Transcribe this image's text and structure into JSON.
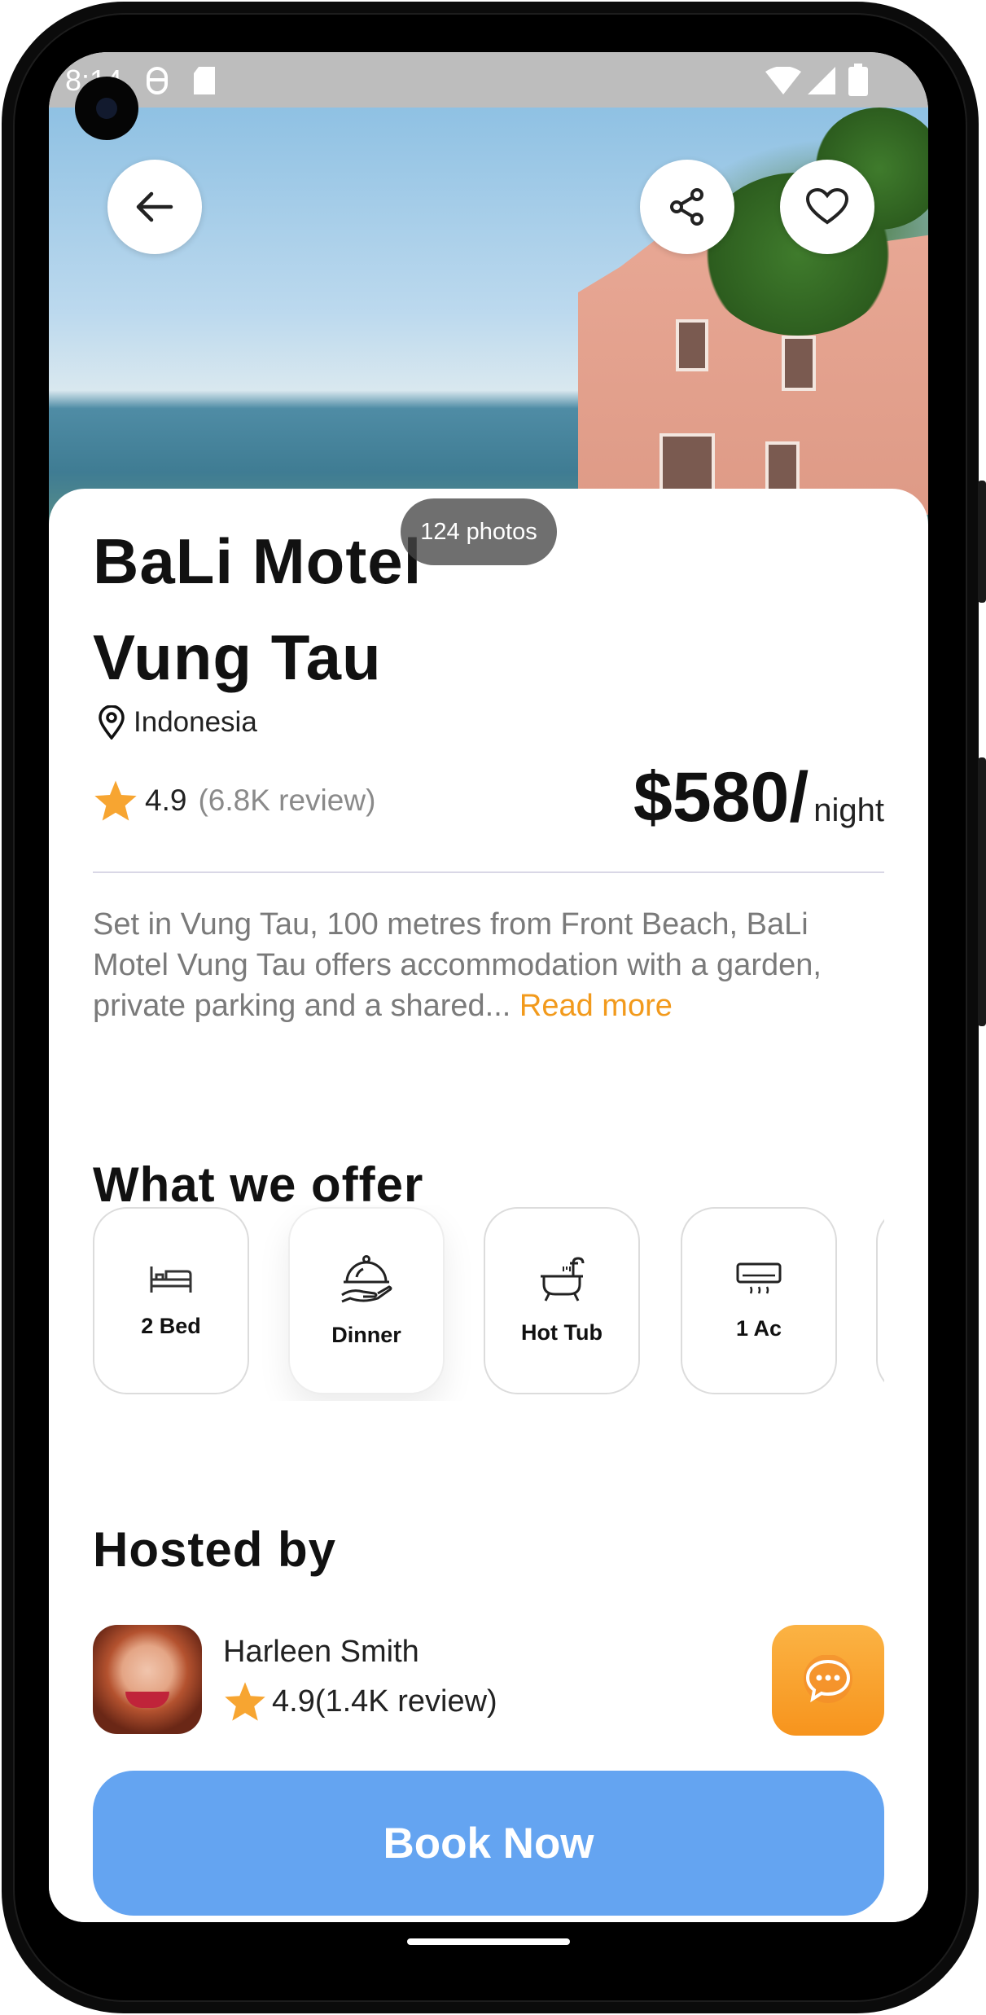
{
  "status_bar": {
    "time": "8:14"
  },
  "hero": {
    "photos_label": "124 photos"
  },
  "listing": {
    "title_line1": "BaLi Motel",
    "title_line2": "Vung Tau",
    "location": "Indonesia",
    "rating": "4.9",
    "reviews": "(6.8K review)",
    "price": "$580/",
    "price_unit": "night",
    "description": "Set in Vung Tau, 100 metres from Front Beach, BaLi Motel Vung Tau offers accommodation with a garden, private parking and a shared...",
    "read_more": "Read more"
  },
  "offers": {
    "heading": "What we offer",
    "items": [
      {
        "label": "2 Bed",
        "icon": "bed-icon"
      },
      {
        "label": "Dinner",
        "icon": "dinner-icon"
      },
      {
        "label": "Hot Tub",
        "icon": "bathtub-icon"
      },
      {
        "label": "1 Ac",
        "icon": "air-conditioner-icon"
      }
    ]
  },
  "host": {
    "heading": "Hosted by",
    "name": "Harleen Smith",
    "rating_text": "4.9(1.4K review)"
  },
  "actions": {
    "book_label": "Book Now"
  },
  "colors": {
    "accent_orange": "#f29a1c",
    "book_blue": "#64a4f1",
    "star": "#f7a531"
  }
}
